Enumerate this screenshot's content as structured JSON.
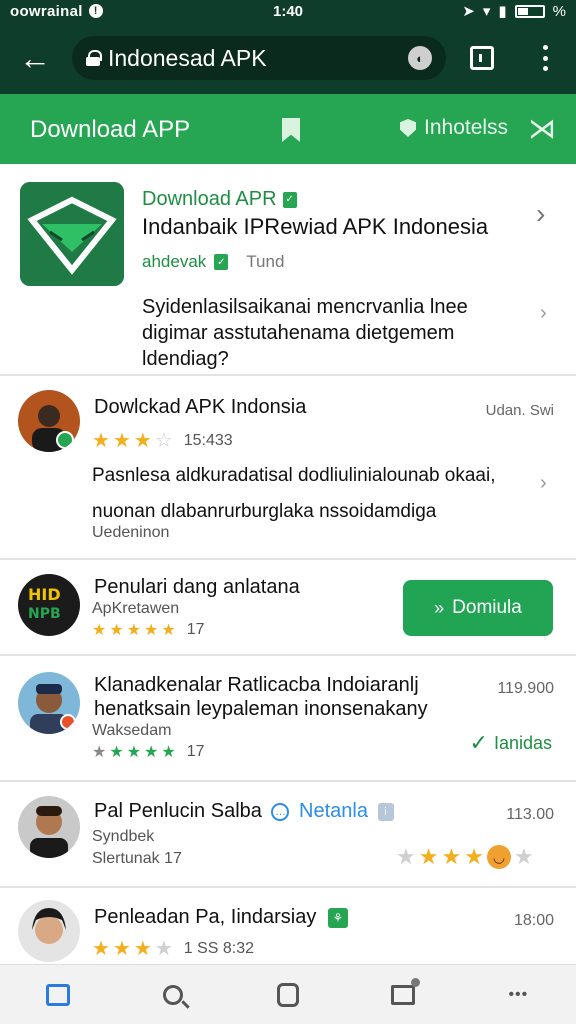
{
  "status_bar": {
    "carrier": "oowrainal",
    "time": "1:40",
    "battery_label": "%"
  },
  "browser": {
    "url_text": "Indonesad APK"
  },
  "app_header": {
    "title": "Download APP",
    "link_label": "Inhotelss"
  },
  "featured": {
    "tag": "Download APR",
    "title": "Indanbaik IPRewiad APK Indonesia",
    "developer": "ahdevak",
    "meta": "Tund",
    "description": "Syidenlasilsaikanai mencrvanlia lnee digimar asstutahenama dietgemem ldendiag?"
  },
  "list": [
    {
      "title": "Dowlckad APK Indonsia",
      "meta_right": "Udan. Swi",
      "rating": 3,
      "rating_text": "15:433",
      "description": "Pasnlesa aldkuradatisal dodliulinialounab okaai, nuonan dlabanrurburglaka nssoidamdiga",
      "sub": "Uedeninon"
    },
    {
      "title": "Penulari dang anlatana",
      "sub": "ApKretawen",
      "rating": 5,
      "rating_text": "17",
      "button_label": "Domiula"
    },
    {
      "title": "Klanadkenalar Ratlicacba Indoiaranlj",
      "title2": "henatksain leypaleman inonsenakany",
      "sub": "Waksedam",
      "rating": 5,
      "rating_text": "17",
      "meta_right": "119.900",
      "status_label": "Ianidas"
    },
    {
      "title": "Pal Penlucin Salba",
      "tag": "Netanla",
      "sub": "Syndbek",
      "sub2": "Slertunak 17",
      "meta_right": "113.00",
      "rating": 3
    },
    {
      "title": "Penleadan Pa, Iindarsiay",
      "rating": 3,
      "rating_text": "1 SS 8:32",
      "meta_right": "18:00"
    }
  ],
  "colors": {
    "status_bg": "#0f3d2c",
    "header_green": "#26a553",
    "accent_green": "#1e8e44",
    "star": "#f2b01e"
  }
}
